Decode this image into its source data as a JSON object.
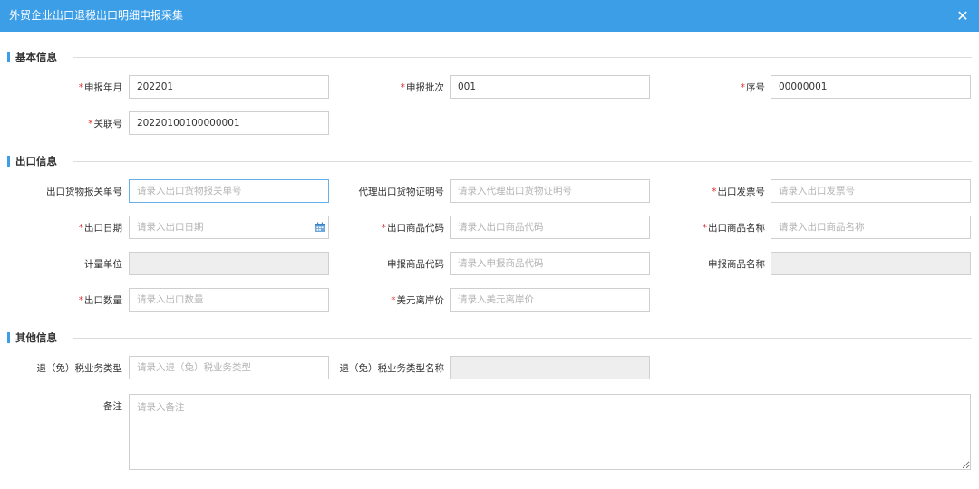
{
  "dialog": {
    "title": "外贸企业出口退税出口明细申报采集",
    "close_icon": "✕"
  },
  "sections": {
    "basic": "基本信息",
    "export": "出口信息",
    "other": "其他信息"
  },
  "required_mark": "*",
  "basic": {
    "period_label": "申报年月",
    "period_value": "202201",
    "batch_label": "申报批次",
    "batch_value": "001",
    "seq_label": "序号",
    "seq_value": "00000001",
    "link_label": "关联号",
    "link_value": "20220100100000001"
  },
  "export": {
    "customs_label": "出口货物报关单号",
    "customs_placeholder": "请录入出口货物报关单号",
    "proxy_label": "代理出口货物证明号",
    "proxy_placeholder": "请录入代理出口货物证明号",
    "invoice_label": "出口发票号",
    "invoice_placeholder": "请录入出口发票号",
    "date_label": "出口日期",
    "date_placeholder": "请录入出口日期",
    "code_label": "出口商品代码",
    "code_placeholder": "请录入出口商品代码",
    "name_label": "出口商品名称",
    "name_placeholder": "请录入出口商品名称",
    "unit_label": "计量单位",
    "decl_code_label": "申报商品代码",
    "decl_code_placeholder": "请录入申报商品代码",
    "decl_name_label": "申报商品名称",
    "qty_label": "出口数量",
    "qty_placeholder": "请录入出口数量",
    "fob_label": "美元离岸价",
    "fob_placeholder": "请录入美元离岸价"
  },
  "other": {
    "type_label": "退（免）税业务类型",
    "type_placeholder": "请录入退（免）税业务类型",
    "type_name_label": "退（免）税业务类型名称",
    "remark_label": "备注",
    "remark_placeholder": "请录入备注"
  },
  "colors": {
    "header": "#3d9ee8",
    "required": "#e3302f",
    "focus_border": "#66afe9"
  },
  "icons": {
    "calendar": "calendar-icon",
    "close": "close-icon"
  }
}
